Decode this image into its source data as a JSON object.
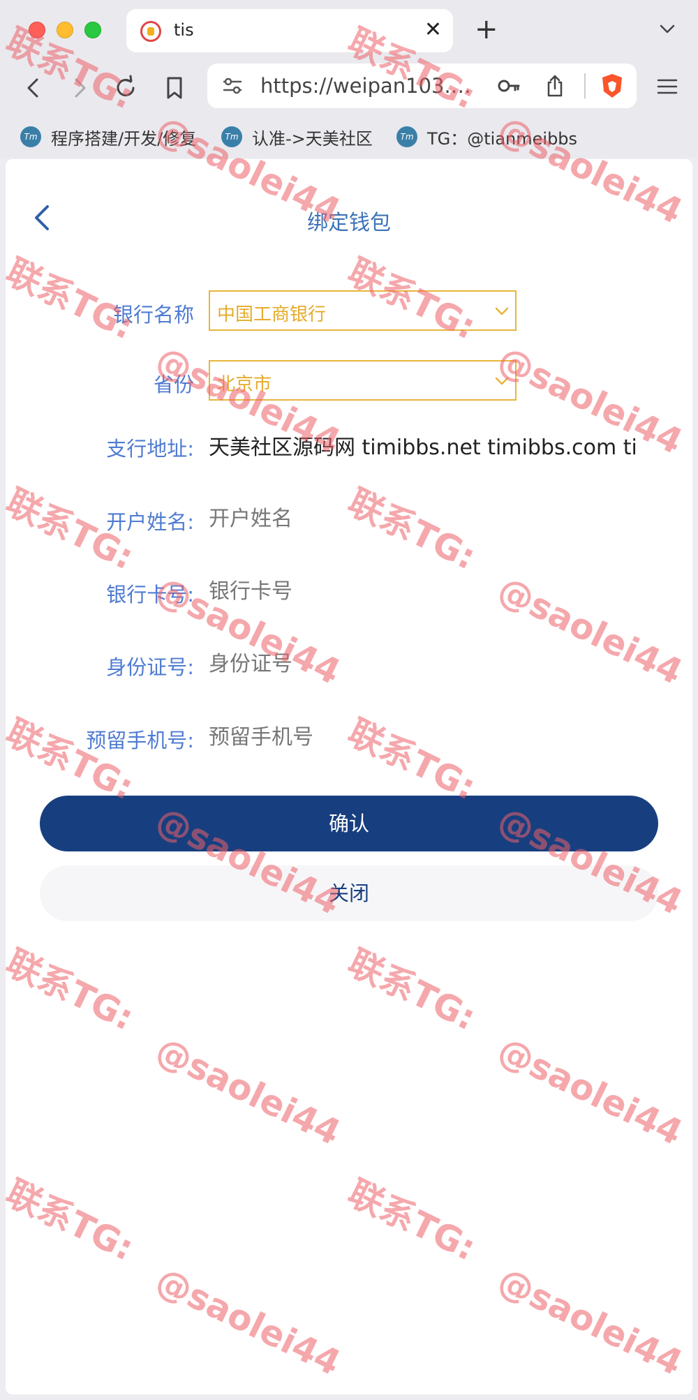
{
  "browser": {
    "tab_title": "tis",
    "url": "https://weipan103.tim...",
    "bookmarks": [
      {
        "label": "程序搭建/开发/修复",
        "icon": "Tm"
      },
      {
        "label": "认准->天美社区",
        "icon": "Tm"
      },
      {
        "label": "TG：@tianmeibbs",
        "icon": "Tm"
      }
    ]
  },
  "page": {
    "title": "绑定钱包",
    "fields": {
      "bank_name": {
        "label": "银行名称",
        "value": "中国工商银行"
      },
      "province": {
        "label": "省份",
        "value": "北京市"
      },
      "branch": {
        "label": "支行地址:",
        "value": "天美社区源码网 timibbs.net timibbs.com ti"
      },
      "holder": {
        "label": "开户姓名:",
        "placeholder": "开户姓名"
      },
      "card": {
        "label": "银行卡号:",
        "placeholder": "银行卡号"
      },
      "id_card": {
        "label": "身份证号:",
        "placeholder": "身份证号"
      },
      "phone": {
        "label": "预留手机号:",
        "placeholder": "预留手机号"
      }
    },
    "confirm_label": "确认",
    "close_label": "关闭"
  },
  "watermark": {
    "line1": "联系TG:",
    "line2": "@saolei44"
  },
  "colors": {
    "primary": "#173f7f",
    "label": "#4f7bd2",
    "select_accent": "#e8b53a",
    "watermark": "#ec6068"
  }
}
